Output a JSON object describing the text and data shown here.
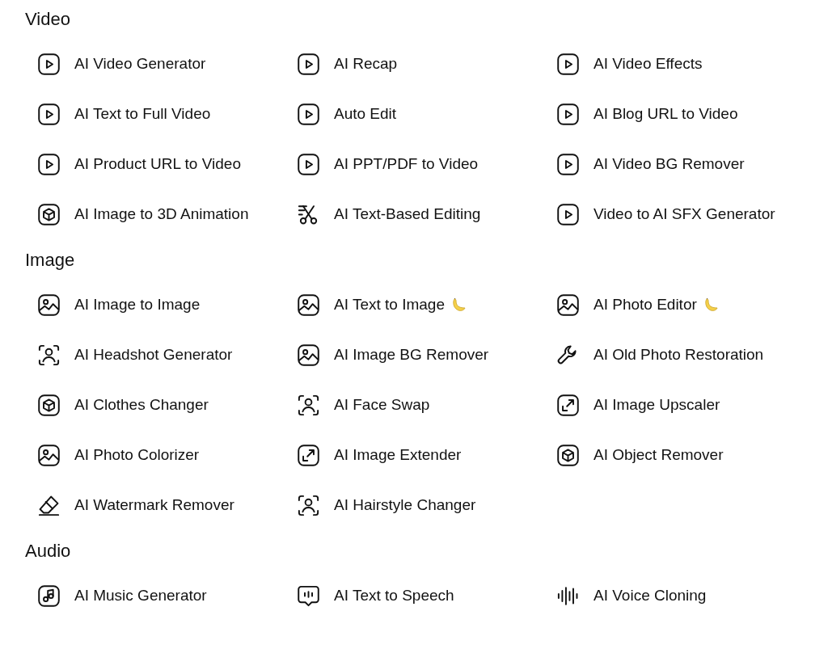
{
  "sections": [
    {
      "title": "Video",
      "items": [
        {
          "label": "AI Video Generator",
          "kind": "play",
          "banana": false
        },
        {
          "label": "AI Recap",
          "kind": "play",
          "banana": false
        },
        {
          "label": "AI Video Effects",
          "kind": "play",
          "banana": false
        },
        {
          "label": "AI Text to Full Video",
          "kind": "play",
          "banana": false
        },
        {
          "label": "Auto Edit",
          "kind": "play",
          "banana": false
        },
        {
          "label": "AI Blog URL to Video",
          "kind": "play",
          "banana": false
        },
        {
          "label": "AI Product URL to Video",
          "kind": "play",
          "banana": false
        },
        {
          "label": "AI PPT/PDF to Video",
          "kind": "play",
          "banana": false
        },
        {
          "label": "AI Video BG Remover",
          "kind": "play",
          "banana": false
        },
        {
          "label": "AI Image to 3D Animation",
          "kind": "cube",
          "banana": false
        },
        {
          "label": "AI Text-Based Editing",
          "kind": "scissors",
          "banana": false
        },
        {
          "label": "Video to AI SFX Generator",
          "kind": "play",
          "banana": false
        }
      ]
    },
    {
      "title": "Image",
      "items": [
        {
          "label": "AI Image to Image",
          "kind": "image",
          "banana": false
        },
        {
          "label": "AI Text to Image",
          "kind": "image",
          "banana": true
        },
        {
          "label": "AI Photo Editor",
          "kind": "image",
          "banana": true
        },
        {
          "label": "AI Headshot Generator",
          "kind": "person",
          "banana": false
        },
        {
          "label": "AI Image BG Remover",
          "kind": "image",
          "banana": false
        },
        {
          "label": "AI Old Photo Restoration",
          "kind": "wrench",
          "banana": false
        },
        {
          "label": "AI Clothes Changer",
          "kind": "cube",
          "banana": false
        },
        {
          "label": "AI Face Swap",
          "kind": "person",
          "banana": false
        },
        {
          "label": "AI Image Upscaler",
          "kind": "expand",
          "banana": false
        },
        {
          "label": "AI Photo Colorizer",
          "kind": "image",
          "banana": false
        },
        {
          "label": "AI Image Extender",
          "kind": "expand",
          "banana": false
        },
        {
          "label": "AI Object Remover",
          "kind": "cube",
          "banana": false
        },
        {
          "label": "AI Watermark Remover",
          "kind": "eraser",
          "banana": false
        },
        {
          "label": "AI Hairstyle Changer",
          "kind": "person",
          "banana": false
        }
      ]
    },
    {
      "title": "Audio",
      "items": [
        {
          "label": "AI Music Generator",
          "kind": "music",
          "banana": false
        },
        {
          "label": "AI Text to Speech",
          "kind": "speech",
          "banana": false
        },
        {
          "label": "AI Voice Cloning",
          "kind": "wave",
          "banana": false
        }
      ]
    }
  ]
}
